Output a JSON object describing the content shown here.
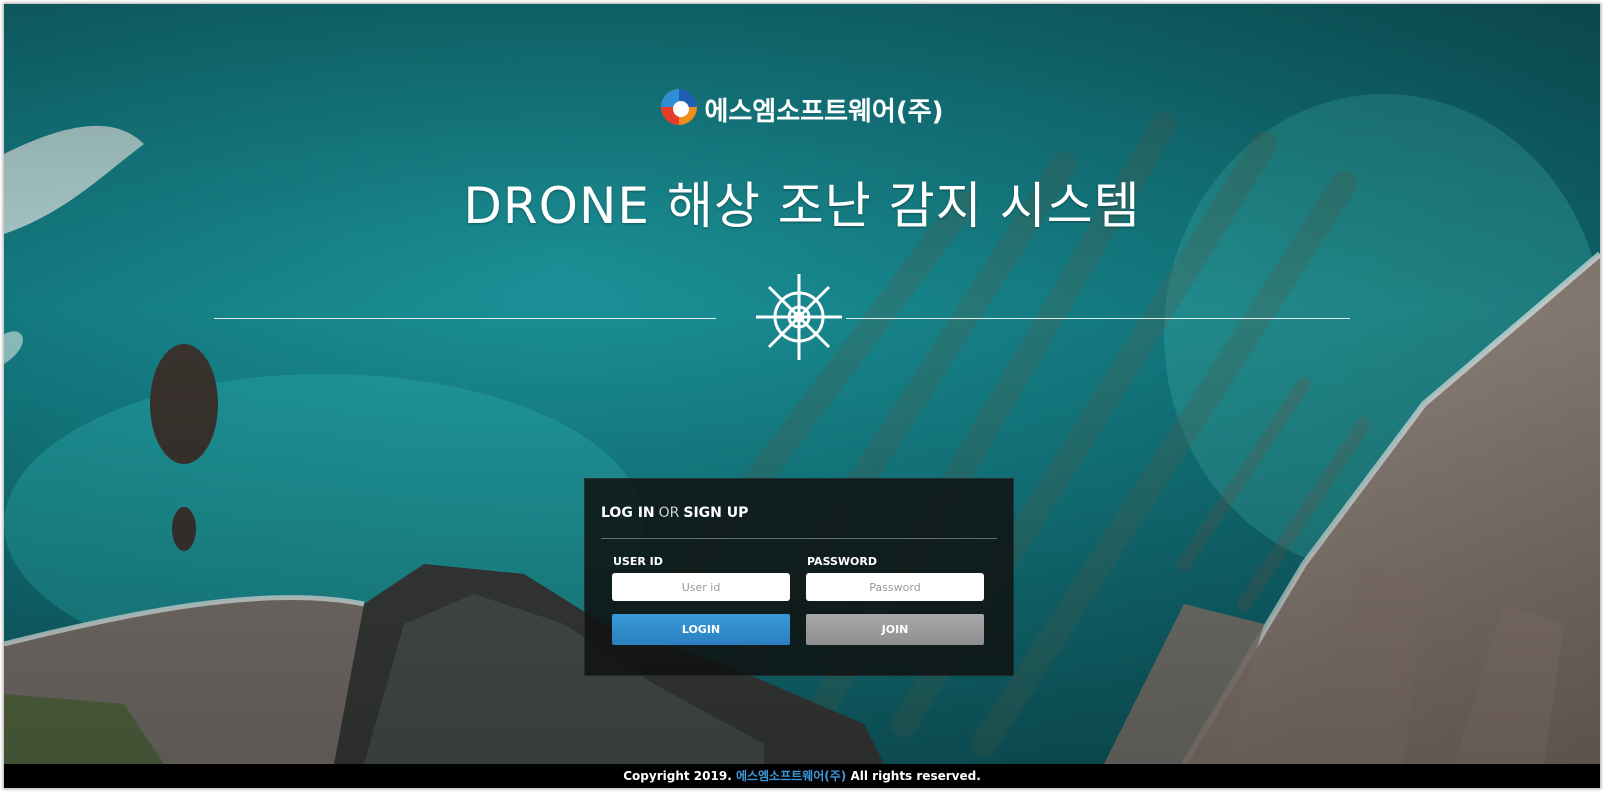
{
  "brand": {
    "name": "에스엠소프트웨어(주)",
    "logo_icon": "company-logo-icon"
  },
  "page": {
    "title": "DRONE 해상 조난 감지 시스템",
    "emblem_icon": "ship-wheel-icon"
  },
  "login": {
    "heading_login": "LOG IN",
    "heading_or": "OR",
    "heading_signup": "SIGN UP",
    "userid_label": "USER ID",
    "userid_placeholder": "User id",
    "userid_value": "",
    "password_label": "PASSWORD",
    "password_placeholder": "Password",
    "password_value": "",
    "login_button": "LOGIN",
    "join_button": "JOIN"
  },
  "footer": {
    "prefix": "Copyright 2019.",
    "company": "에스엠소프트웨어(주)",
    "suffix": "All rights reserved."
  },
  "colors": {
    "accent_blue": "#2f8fd0",
    "join_gray": "#9a9a9a",
    "sea_teal": "#1a8b8f",
    "panel_dark": "#0f1112"
  }
}
